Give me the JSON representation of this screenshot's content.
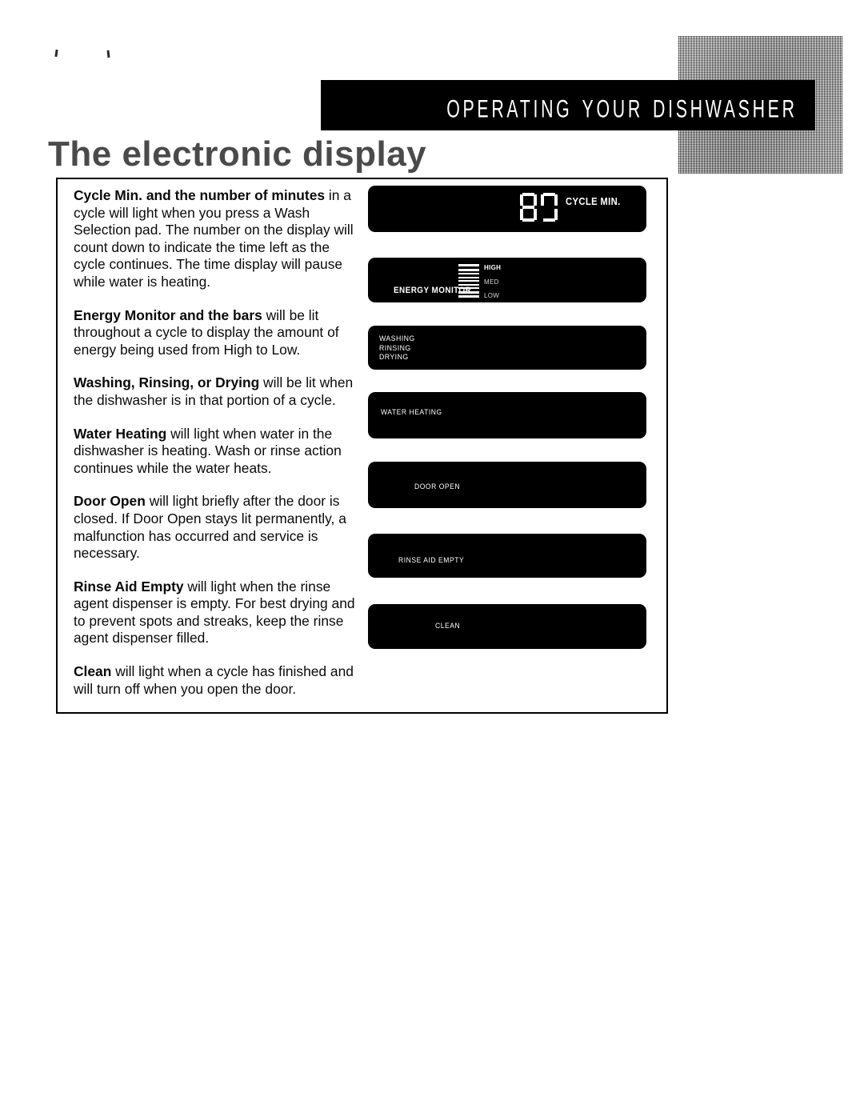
{
  "header": {
    "section_title": "Operating Your Dishwasher",
    "subtitle": "The electronic display"
  },
  "body": {
    "paragraphs": [
      {
        "lead": "Cycle Min. and the number of minutes",
        "rest": " in a cycle will light when you press a Wash Selection pad. The number on the display will count down to indicate the time left as the cycle continues. The time display will pause while water is heating."
      },
      {
        "lead": "Energy Monitor and the bars",
        "rest": " will be lit throughout a cycle to display the amount of energy being used from High to Low."
      },
      {
        "lead": "Washing, Rinsing, or Drying",
        "rest": " will be lit when the dishwasher is in that portion of a cycle."
      },
      {
        "lead": "Water Heating",
        "rest": " will light when water in the dishwasher is heating. Wash or rinse action continues while the water heats."
      },
      {
        "lead": "Door Open",
        "rest": " will light briefly after the door is closed. If Door Open stays lit permanently, a malfunction has occurred and service is necessary."
      },
      {
        "lead": "Rinse Aid Empty",
        "rest": " will light when the rinse agent dispenser is empty. For best drying and to prevent spots and streaks, keep the rinse agent dispenser filled."
      },
      {
        "lead": "Clean",
        "rest": " will light when a cycle has finished and will turn off when you open the door."
      }
    ]
  },
  "panels": {
    "cycle_min": {
      "digits": "80",
      "label": "CYCLE MIN."
    },
    "energy_monitor": {
      "label": "ENERGY MONITOR",
      "ticks": {
        "high": "HIGH",
        "med": "MED",
        "low": "LOW"
      },
      "bar_count": 9
    },
    "cycle_state": {
      "washing": "WASHING",
      "rinsing": "RINSING",
      "drying": "DRYING"
    },
    "water_heating": {
      "label": "WATER HEATING"
    },
    "door_open": {
      "label": "DOOR OPEN"
    },
    "rinse_aid": {
      "label": "RINSE AID EMPTY"
    },
    "clean": {
      "label": "CLEAN"
    }
  },
  "colors": {
    "panel_background": "#000000",
    "panel_text": "#ffffff",
    "page_background": "#ffffff",
    "header_bar": "#000000",
    "subtitle_gray": "#4a4a4a"
  }
}
